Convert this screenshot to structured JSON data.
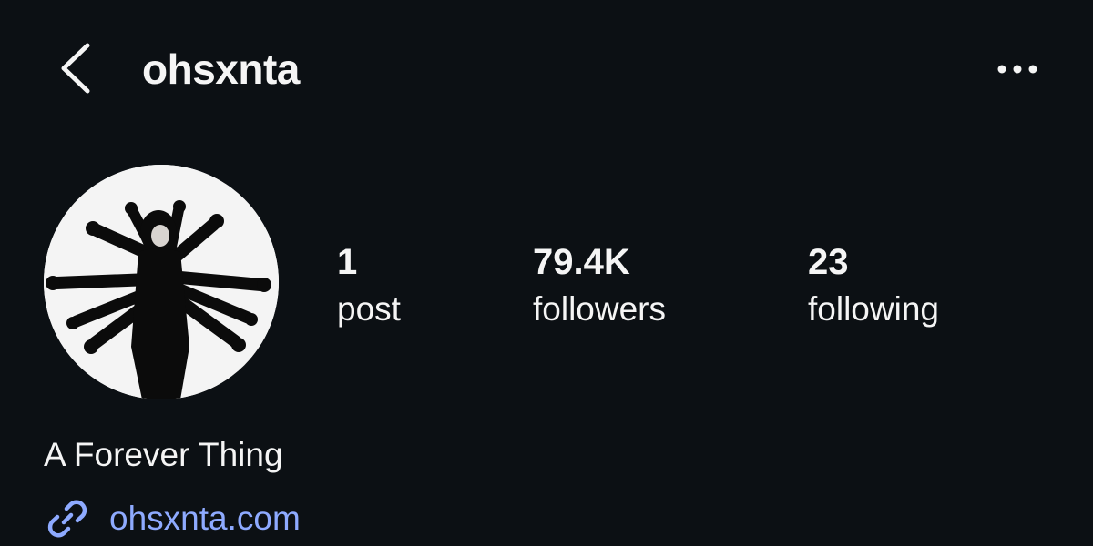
{
  "header": {
    "back_icon": "chevron-left-icon",
    "username": "ohsxnta",
    "more_icon": "more-horizontal-icon"
  },
  "profile": {
    "avatar": "profile-photo",
    "stats": {
      "posts": {
        "count": "1",
        "label": "post"
      },
      "followers": {
        "count": "79.4K",
        "label": "followers"
      },
      "following": {
        "count": "23",
        "label": "following"
      }
    },
    "bio": "A Forever Thing",
    "website": {
      "icon": "link-icon",
      "text": "ohsxnta.com"
    }
  },
  "colors": {
    "background": "#0c1014",
    "text": "#f5f5f5",
    "link": "#8eaaff"
  }
}
